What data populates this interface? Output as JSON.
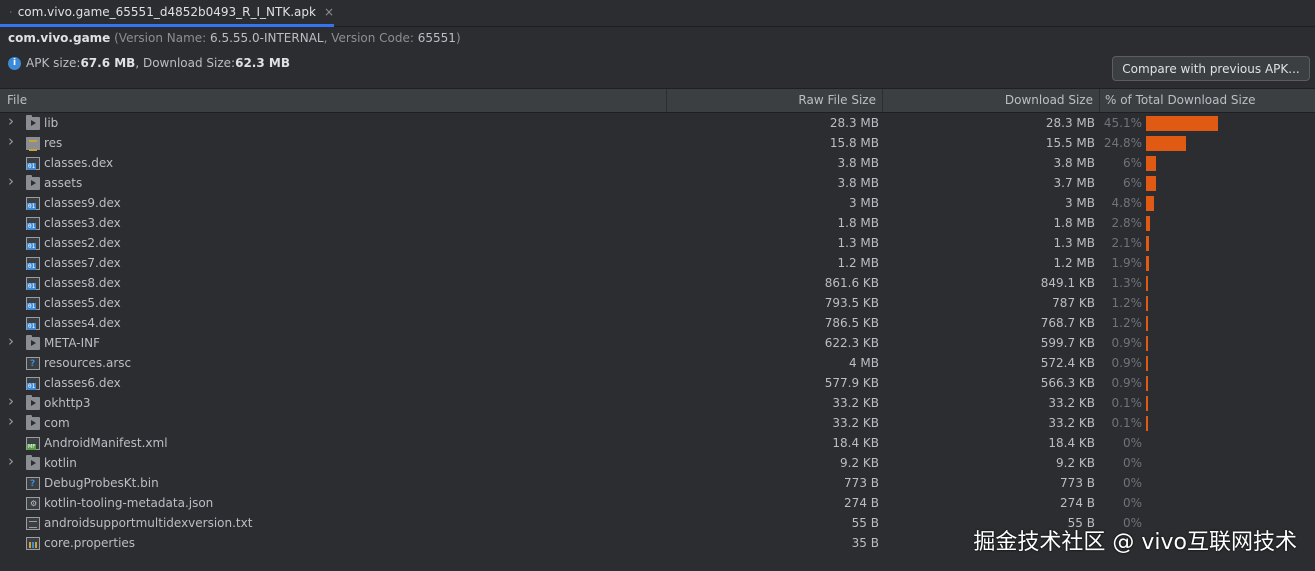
{
  "tab": {
    "title": "com.vivo.game_65551_d4852b0493_R_I_NTK.apk",
    "close": "×"
  },
  "info": {
    "package": "com.vivo.game",
    "version_open": " (Version Name: ",
    "version_name": "6.5.55.0-INTERNAL",
    "version_mid": ", Version Code: ",
    "version_code": "65551",
    "version_close": ")"
  },
  "size": {
    "apk_label": "APK size: ",
    "apk_size": "67.6 MB",
    "dl_label": ", Download Size: ",
    "dl_size": "62.3 MB"
  },
  "compare_button": "Compare with previous APK...",
  "columns": {
    "file": "File",
    "raw": "Raw File Size",
    "download": "Download Size",
    "percent": "% of Total Download Size"
  },
  "rows": [
    {
      "name": "lib",
      "icon": "folder-icon",
      "expandable": true,
      "raw": "28.3 MB",
      "dl": "28.3 MB",
      "pct": "45.1%",
      "fraction": 0.451
    },
    {
      "name": "res",
      "icon": "res-folder-icon",
      "expandable": true,
      "raw": "15.8 MB",
      "dl": "15.5 MB",
      "pct": "24.8%",
      "fraction": 0.248
    },
    {
      "name": "classes.dex",
      "icon": "dex-file-icon",
      "expandable": false,
      "raw": "3.8 MB",
      "dl": "3.8 MB",
      "pct": "6%",
      "fraction": 0.06
    },
    {
      "name": "assets",
      "icon": "folder-icon",
      "expandable": true,
      "raw": "3.8 MB",
      "dl": "3.7 MB",
      "pct": "6%",
      "fraction": 0.06
    },
    {
      "name": "classes9.dex",
      "icon": "dex-file-icon",
      "expandable": false,
      "raw": "3 MB",
      "dl": "3 MB",
      "pct": "4.8%",
      "fraction": 0.048
    },
    {
      "name": "classes3.dex",
      "icon": "dex-file-icon",
      "expandable": false,
      "raw": "1.8 MB",
      "dl": "1.8 MB",
      "pct": "2.8%",
      "fraction": 0.028
    },
    {
      "name": "classes2.dex",
      "icon": "dex-file-icon",
      "expandable": false,
      "raw": "1.3 MB",
      "dl": "1.3 MB",
      "pct": "2.1%",
      "fraction": 0.021
    },
    {
      "name": "classes7.dex",
      "icon": "dex-file-icon",
      "expandable": false,
      "raw": "1.2 MB",
      "dl": "1.2 MB",
      "pct": "1.9%",
      "fraction": 0.019
    },
    {
      "name": "classes8.dex",
      "icon": "dex-file-icon",
      "expandable": false,
      "raw": "861.6 KB",
      "dl": "849.1 KB",
      "pct": "1.3%",
      "fraction": 0.013
    },
    {
      "name": "classes5.dex",
      "icon": "dex-file-icon",
      "expandable": false,
      "raw": "793.5 KB",
      "dl": "787 KB",
      "pct": "1.2%",
      "fraction": 0.012
    },
    {
      "name": "classes4.dex",
      "icon": "dex-file-icon",
      "expandable": false,
      "raw": "786.5 KB",
      "dl": "768.7 KB",
      "pct": "1.2%",
      "fraction": 0.012
    },
    {
      "name": "META-INF",
      "icon": "folder-icon",
      "expandable": true,
      "raw": "622.3 KB",
      "dl": "599.7 KB",
      "pct": "0.9%",
      "fraction": 0.009
    },
    {
      "name": "resources.arsc",
      "icon": "generic-file-icon",
      "expandable": false,
      "raw": "4 MB",
      "dl": "572.4 KB",
      "pct": "0.9%",
      "fraction": 0.009
    },
    {
      "name": "classes6.dex",
      "icon": "dex-file-icon",
      "expandable": false,
      "raw": "577.9 KB",
      "dl": "566.3 KB",
      "pct": "0.9%",
      "fraction": 0.009
    },
    {
      "name": "okhttp3",
      "icon": "folder-icon",
      "expandable": true,
      "raw": "33.2 KB",
      "dl": "33.2 KB",
      "pct": "0.1%",
      "fraction": 0.001
    },
    {
      "name": "com",
      "icon": "folder-icon",
      "expandable": true,
      "raw": "33.2 KB",
      "dl": "33.2 KB",
      "pct": "0.1%",
      "fraction": 0.001
    },
    {
      "name": "AndroidManifest.xml",
      "icon": "manifest-file-icon",
      "expandable": false,
      "raw": "18.4 KB",
      "dl": "18.4 KB",
      "pct": "0%",
      "fraction": 0
    },
    {
      "name": "kotlin",
      "icon": "folder-icon",
      "expandable": true,
      "raw": "9.2 KB",
      "dl": "9.2 KB",
      "pct": "0%",
      "fraction": 0
    },
    {
      "name": "DebugProbesKt.bin",
      "icon": "generic-file-icon",
      "expandable": false,
      "raw": "773 B",
      "dl": "773 B",
      "pct": "0%",
      "fraction": 0
    },
    {
      "name": "kotlin-tooling-metadata.json",
      "icon": "json-file-icon",
      "expandable": false,
      "raw": "274 B",
      "dl": "274 B",
      "pct": "0%",
      "fraction": 0
    },
    {
      "name": "androidsupportmultidexversion.txt",
      "icon": "text-file-icon",
      "expandable": false,
      "raw": "55 B",
      "dl": "55 B",
      "pct": "0%",
      "fraction": 0
    },
    {
      "name": "core.properties",
      "icon": "properties-file-icon",
      "expandable": false,
      "raw": "35 B",
      "dl": "",
      "pct": "",
      "fraction": 0
    }
  ],
  "watermark": "掘金技术社区 @ vivo互联网技术",
  "colors": {
    "bar": "#e05a14",
    "accent_tab": "#3574f0"
  }
}
